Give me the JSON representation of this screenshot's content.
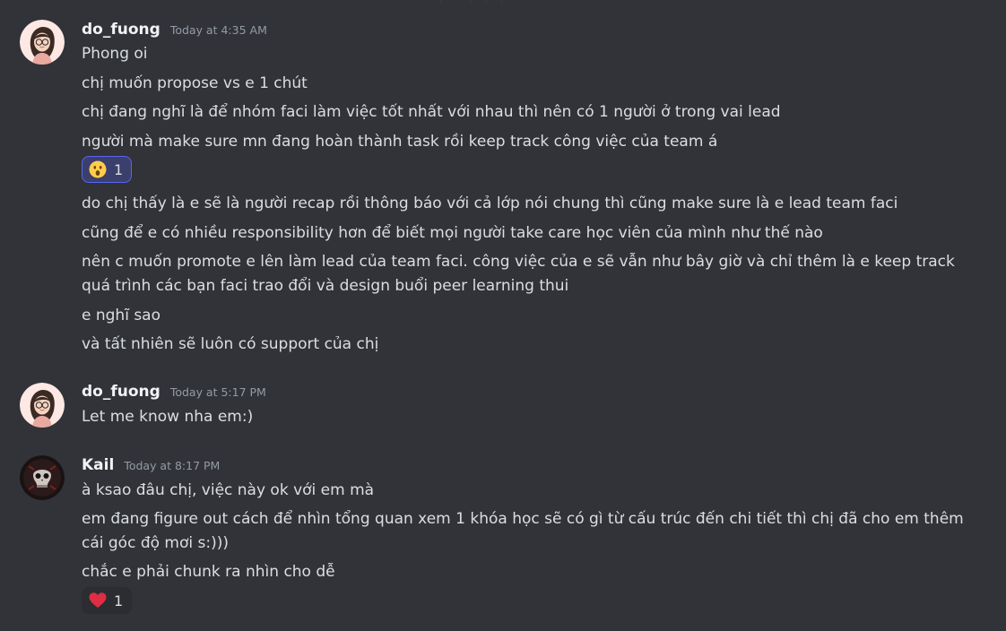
{
  "messages": [
    {
      "author": "do_fuong",
      "timestamp": "Today at 4:35 AM",
      "lines": [
        "Phong oi",
        "chị muốn propose vs e 1 chút",
        "chị đang nghĩ là để nhóm faci làm việc tốt nhất với nhau thì nên có 1 người ở trong vai lead",
        "người mà make sure mn đang hoàn thành task rồi keep track công việc của team á",
        "do chị thấy là e sẽ là người recap rồi thông báo với cả lớp nói chung thì cũng make sure là e lead team faci",
        "cũng để e có nhiều responsibility hơn để biết mọi người take care học viên của mình như thế nào",
        "nên c muốn promote e lên làm lead của team faci. công việc của e sẽ vẫn như bây giờ và chỉ thêm là e keep track quá trình các bạn faci trao đổi và design buổi peer learning thui",
        "e nghĩ sao",
        "và tất nhiên sẽ luôn có support của chị"
      ],
      "reaction": {
        "icon": "astonished-face-icon",
        "count": "1",
        "color": "#5865f2"
      }
    },
    {
      "author": "do_fuong",
      "timestamp": "Today at 5:17 PM",
      "lines": [
        "Let me know nha em:)"
      ]
    },
    {
      "author": "Kail",
      "timestamp": "Today at 8:17 PM",
      "lines": [
        "à ksao đâu chị, việc này ok với em mà",
        "em đang figure out cách để nhìn tổng quan xem 1 khóa học sẽ có gì từ cấu trúc đến chi tiết thì chị đã cho em thêm cái góc độ mơi s:)))",
        "chắc e phải chunk ra nhìn cho dễ"
      ],
      "reaction": {
        "icon": "red-heart-icon",
        "count": "1",
        "color": "#dd2e44"
      }
    }
  ],
  "theme": {
    "background": "#313338",
    "text": "#dbdee1",
    "muted": "#949ba4",
    "accent": "#5865f2"
  }
}
